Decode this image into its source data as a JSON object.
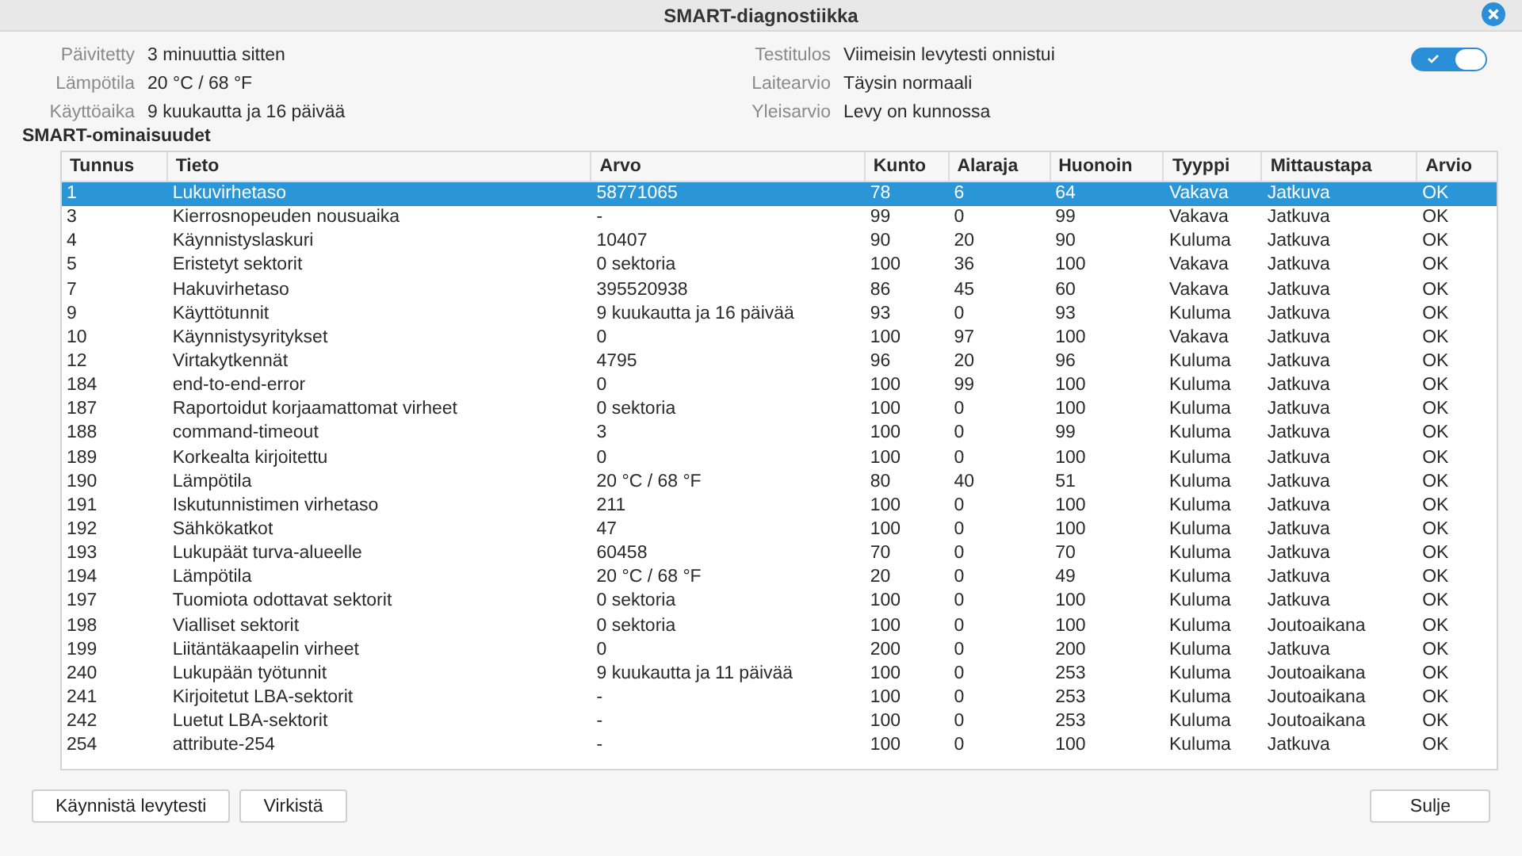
{
  "window": {
    "title": "SMART-diagnostiikka"
  },
  "info_left": [
    {
      "label": "Päivitetty",
      "value": "3 minuuttia sitten"
    },
    {
      "label": "Lämpötila",
      "value": "20 °C / 68 °F"
    },
    {
      "label": "Käyttöaika",
      "value": "9 kuukautta ja 16 päivää"
    }
  ],
  "info_right": [
    {
      "label": "Testitulos",
      "value": "Viimeisin levytesti onnistui"
    },
    {
      "label": "Laitearvio",
      "value": "Täysin normaali"
    },
    {
      "label": "Yleisarvio",
      "value": "Levy on kunnossa"
    }
  ],
  "smart_toggle": {
    "on": true
  },
  "section_title": "SMART-ominaisuudet",
  "table": {
    "columns": [
      "Tunnus",
      "Tieto",
      "Arvo",
      "Kunto",
      "Alaraja",
      "Huonoin",
      "Tyyppi",
      "Mittaustapa",
      "Arvio"
    ],
    "rows": [
      {
        "cells": [
          "1",
          "Lukuvirhetaso",
          "58771065",
          "78",
          "6",
          "64",
          "Vakava",
          "Jatkuva",
          "OK"
        ],
        "selected": true
      },
      {
        "cells": [
          "3",
          "Kierrosnopeuden nousuaika",
          "-",
          "99",
          "0",
          "99",
          "Vakava",
          "Jatkuva",
          "OK"
        ],
        "selected": false
      },
      {
        "cells": [
          "4",
          "Käynnistyslaskuri",
          "10407",
          "90",
          "20",
          "90",
          "Kuluma",
          "Jatkuva",
          "OK"
        ],
        "selected": false
      },
      {
        "cells": [
          "5",
          "Eristetyt sektorit",
          "0 sektoria",
          "100",
          "36",
          "100",
          "Vakava",
          "Jatkuva",
          "OK"
        ],
        "selected": false
      },
      {
        "cells": [
          "7",
          "Hakuvirhetaso",
          "395520938",
          "86",
          "45",
          "60",
          "Vakava",
          "Jatkuva",
          "OK"
        ],
        "selected": false
      },
      {
        "cells": [
          "9",
          "Käyttötunnit",
          "9 kuukautta ja 16 päivää",
          "93",
          "0",
          "93",
          "Kuluma",
          "Jatkuva",
          "OK"
        ],
        "selected": false
      },
      {
        "cells": [
          "10",
          "Käynnistysyritykset",
          "0",
          "100",
          "97",
          "100",
          "Vakava",
          "Jatkuva",
          "OK"
        ],
        "selected": false
      },
      {
        "cells": [
          "12",
          "Virtakytkennät",
          "4795",
          "96",
          "20",
          "96",
          "Kuluma",
          "Jatkuva",
          "OK"
        ],
        "selected": false
      },
      {
        "cells": [
          "184",
          "end-to-end-error",
          "0",
          "100",
          "99",
          "100",
          "Kuluma",
          "Jatkuva",
          "OK"
        ],
        "selected": false
      },
      {
        "cells": [
          "187",
          "Raportoidut korjaamattomat virheet",
          "0 sektoria",
          "100",
          "0",
          "100",
          "Kuluma",
          "Jatkuva",
          "OK"
        ],
        "selected": false
      },
      {
        "cells": [
          "188",
          "command-timeout",
          "3",
          "100",
          "0",
          "99",
          "Kuluma",
          "Jatkuva",
          "OK"
        ],
        "selected": false
      },
      {
        "cells": [
          "189",
          "Korkealta kirjoitettu",
          "0",
          "100",
          "0",
          "100",
          "Kuluma",
          "Jatkuva",
          "OK"
        ],
        "selected": false
      },
      {
        "cells": [
          "190",
          "Lämpötila",
          "20 °C / 68 °F",
          "80",
          "40",
          "51",
          "Kuluma",
          "Jatkuva",
          "OK"
        ],
        "selected": false
      },
      {
        "cells": [
          "191",
          "Iskutunnistimen virhetaso",
          "211",
          "100",
          "0",
          "100",
          "Kuluma",
          "Jatkuva",
          "OK"
        ],
        "selected": false
      },
      {
        "cells": [
          "192",
          "Sähkökatkot",
          "47",
          "100",
          "0",
          "100",
          "Kuluma",
          "Jatkuva",
          "OK"
        ],
        "selected": false
      },
      {
        "cells": [
          "193",
          "Lukupäät turva-alueelle",
          "60458",
          "70",
          "0",
          "70",
          "Kuluma",
          "Jatkuva",
          "OK"
        ],
        "selected": false
      },
      {
        "cells": [
          "194",
          "Lämpötila",
          "20 °C / 68 °F",
          "20",
          "0",
          "49",
          "Kuluma",
          "Jatkuva",
          "OK"
        ],
        "selected": false
      },
      {
        "cells": [
          "197",
          "Tuomiota odottavat sektorit",
          "0 sektoria",
          "100",
          "0",
          "100",
          "Kuluma",
          "Jatkuva",
          "OK"
        ],
        "selected": false
      },
      {
        "cells": [
          "198",
          "Vialliset sektorit",
          "0 sektoria",
          "100",
          "0",
          "100",
          "Kuluma",
          "Joutoaikana",
          "OK"
        ],
        "selected": false
      },
      {
        "cells": [
          "199",
          "Liitäntäkaapelin virheet",
          "0",
          "200",
          "0",
          "200",
          "Kuluma",
          "Jatkuva",
          "OK"
        ],
        "selected": false
      },
      {
        "cells": [
          "240",
          "Lukupään työtunnit",
          "9 kuukautta ja 11 päivää",
          "100",
          "0",
          "253",
          "Kuluma",
          "Joutoaikana",
          "OK"
        ],
        "selected": false
      },
      {
        "cells": [
          "241",
          "Kirjoitetut LBA-sektorit",
          "-",
          "100",
          "0",
          "253",
          "Kuluma",
          "Joutoaikana",
          "OK"
        ],
        "selected": false
      },
      {
        "cells": [
          "242",
          "Luetut LBA-sektorit",
          "-",
          "100",
          "0",
          "253",
          "Kuluma",
          "Joutoaikana",
          "OK"
        ],
        "selected": false
      },
      {
        "cells": [
          "254",
          "attribute-254",
          "-",
          "100",
          "0",
          "100",
          "Kuluma",
          "Jatkuva",
          "OK"
        ],
        "selected": false
      }
    ]
  },
  "buttons_left": [
    "Käynnistä levytesti",
    "Virkistä"
  ],
  "buttons_right": [
    "Sulje"
  ]
}
